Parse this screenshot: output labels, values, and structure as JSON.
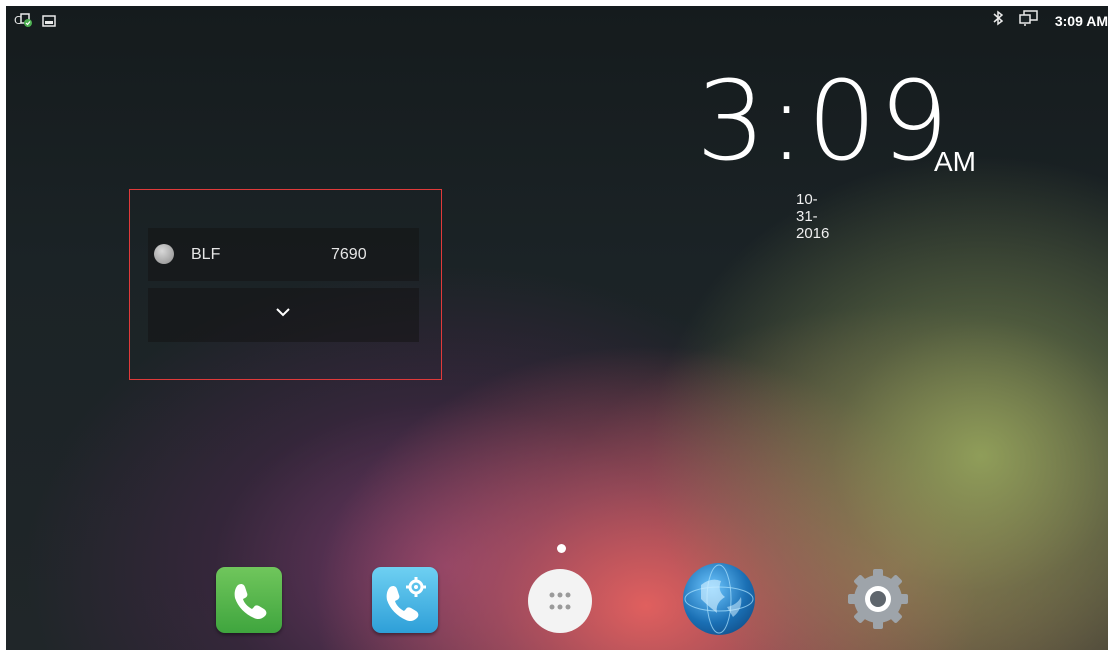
{
  "status_bar": {
    "left_icons": [
      "sip-account-icon",
      "image-icon"
    ],
    "right_icons": [
      "bluetooth-icon",
      "screen-mirror-icon"
    ],
    "time": "3:09 AM"
  },
  "clock_widget": {
    "time": "3:09",
    "ampm": "AM",
    "date": "10-31-2016"
  },
  "blf_widget": {
    "label": "BLF",
    "number": "7690",
    "status_color": "#a0a0a0",
    "highlight_border_color": "#e03a3a"
  },
  "dock": {
    "apps": [
      {
        "name": "phone-app-icon"
      },
      {
        "name": "call-settings-app-icon"
      },
      {
        "name": "app-drawer-icon"
      },
      {
        "name": "browser-app-icon"
      },
      {
        "name": "settings-app-icon"
      }
    ]
  }
}
